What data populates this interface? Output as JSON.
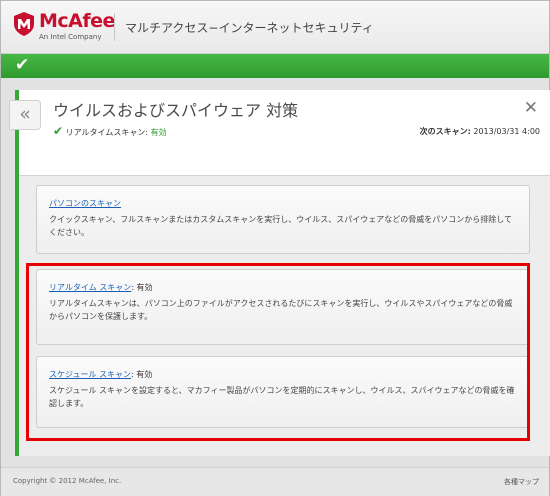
{
  "header": {
    "brand": "McAfee",
    "tagline": "An Intel Company",
    "product_title": "マルチアクセス−インターネットセキュリティ"
  },
  "status_bar": {
    "icon": "check-icon"
  },
  "panel": {
    "back_icon": "«",
    "title": "ウイルスおよびスパイウェア 対策",
    "close_icon": "✕",
    "realtime_label": "リアルタイムスキャン:",
    "realtime_status": "有効",
    "next_scan_label": "次のスキャン:",
    "next_scan_value": "2013/03/31 4:00"
  },
  "cards": [
    {
      "title_link": "パソコンのスキャン",
      "suffix": "",
      "desc": "クイックスキャン、フルスキャンまたはカスタムスキャンを実行し、ウイルス、スパイウェアなどの脅威をパソコンから排除してください。"
    },
    {
      "title_link": "リアルタイム スキャン",
      "suffix": ": 有効",
      "desc": "リアルタイムスキャンは、パソコン上のファイルがアクセスされるたびにスキャンを実行し、ウイルスやスパイウェアなどの脅威からパソコンを保護します。"
    },
    {
      "title_link": "スケジュール スキャン",
      "suffix": ": 有効",
      "desc": "スケジュール スキャンを設定すると、マカフィー製品がパソコンを定期的にスキャンし、ウイルス、スパイウェアなどの脅威を確認します。"
    }
  ],
  "footer": {
    "copyright": "Copyright © 2012 McAfee, Inc.",
    "sitemap": "各種マップ"
  },
  "colors": {
    "brand_red": "#c8102e",
    "status_green": "#35a835",
    "link_blue": "#1a5fb4",
    "highlight_red": "#e60000"
  }
}
